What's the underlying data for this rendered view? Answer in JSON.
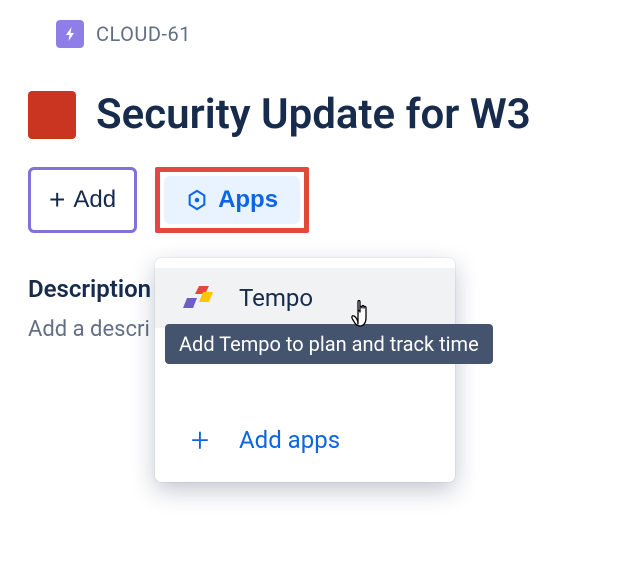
{
  "breadcrumb": {
    "issue_key": "CLOUD-61"
  },
  "issue": {
    "title": "Security Update for W3"
  },
  "buttons": {
    "add": "Add",
    "apps": "Apps"
  },
  "description": {
    "label": "Description",
    "placeholder": "Add a descri"
  },
  "dropdown": {
    "items": [
      {
        "label": "Tempo"
      }
    ],
    "add_apps": "Add apps"
  },
  "tooltip": {
    "text": "Add Tempo to plan and track time"
  }
}
